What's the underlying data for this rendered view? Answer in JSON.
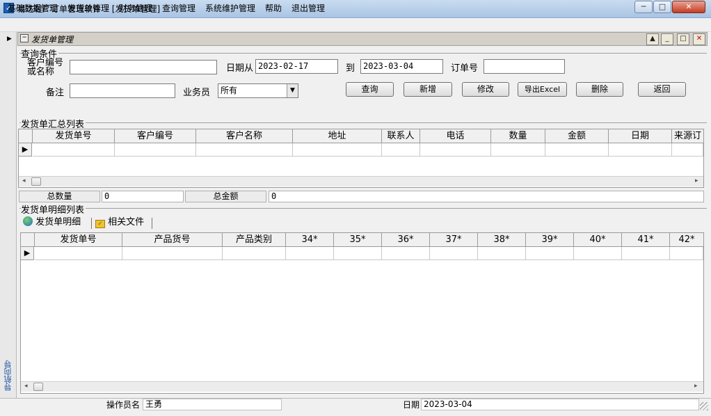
{
  "window": {
    "title": "易达鞋厂订单管理软件  - [发货单管理]",
    "minimize_glyph": "─",
    "maximize_glyph": "□",
    "close_glyph": "✕"
  },
  "menu": [
    "基础数据管理",
    "发货单管理",
    "财务管理",
    "查询管理",
    "系统维护管理",
    "帮助",
    "退出管理"
  ],
  "child_window": {
    "title": "发货单管理"
  },
  "left_nav": {
    "label": "导航向导"
  },
  "query": {
    "group_label": "查询条件",
    "customer_label_1": "客户编号",
    "customer_label_2": "或名称",
    "customer_value": "",
    "date_from_label": "日期从",
    "date_from_value": "2023-02-17",
    "date_to_label": "到",
    "date_to_value": "2023-03-04",
    "order_no_label": "订单号",
    "order_no_value": "",
    "remark_label": "备注",
    "remark_value": "",
    "salesman_label": "业务员",
    "salesman_value": "所有"
  },
  "buttons": {
    "query": "查询",
    "add": "新增",
    "modify": "修改",
    "export": "导出Excel",
    "delete": "删除",
    "back": "返回"
  },
  "summary_list": {
    "group_label": "发货单汇总列表",
    "columns": [
      "发货单号",
      "客户编号",
      "客户名称",
      "地址",
      "联系人",
      "电话",
      "数量",
      "金额",
      "日期",
      "来源订"
    ],
    "total_qty_label": "总数量",
    "total_qty_value": "0",
    "total_amount_label": "总金额",
    "total_amount_value": "0"
  },
  "detail_list": {
    "group_label": "发货单明细列表",
    "tabs": [
      "发货单明细",
      "相关文件"
    ],
    "columns": [
      "发货单号",
      "产品货号",
      "产品类别",
      "34*",
      "35*",
      "36*",
      "37*",
      "38*",
      "39*",
      "40*",
      "41*",
      "42*"
    ]
  },
  "status": {
    "operator_label": "操作员名",
    "operator_value": "王勇",
    "date_label": "日期",
    "date_value": "2023-03-04"
  }
}
